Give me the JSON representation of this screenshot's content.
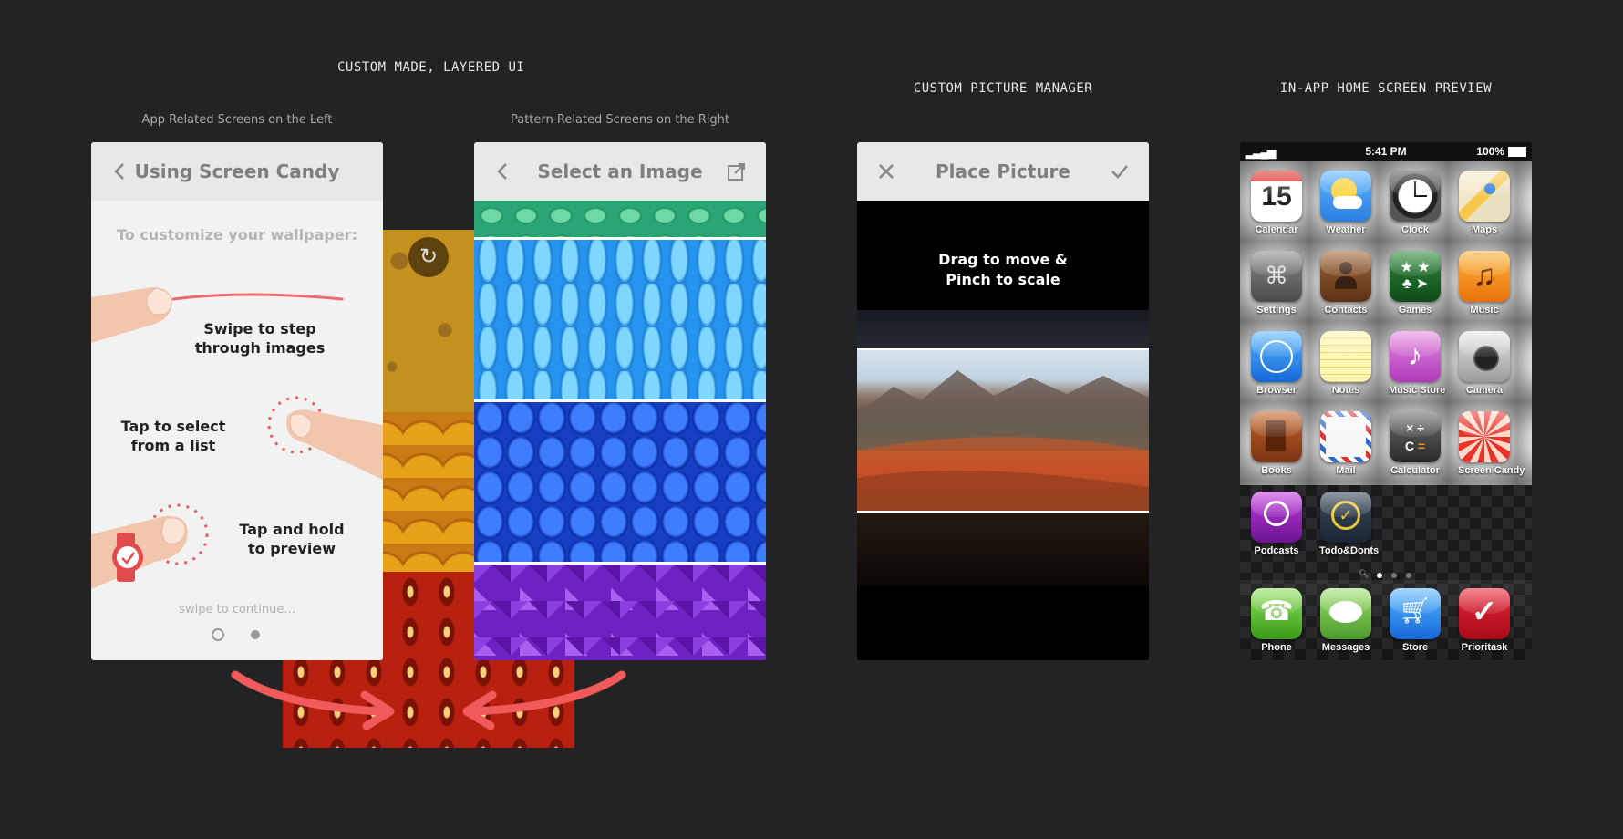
{
  "headings": {
    "layered": "CUSTOM MADE, LAYERED UI",
    "picture_manager": "CUSTOM PICTURE MANAGER",
    "home_preview": "IN-APP HOME SCREEN PREVIEW"
  },
  "captions": {
    "left": "App Related Screens on the Left",
    "right": "Pattern Related Screens on the Right"
  },
  "screen_help": {
    "title": "Using Screen Candy",
    "subtitle": "To customize your wallpaper:",
    "swipe": "Swipe to step\nthrough images",
    "tap": "Tap to select\nfrom a list",
    "hold": "Tap and hold\nto preview",
    "continue": "swipe to continue...",
    "page_count": 2,
    "active_page": 0
  },
  "screen_select": {
    "title": "Select an Image",
    "patterns": [
      "green-bubbles",
      "blue-drops",
      "blue-cobbles",
      "purple-crystals"
    ]
  },
  "screen_place": {
    "title": "Place Picture",
    "instruction": "Drag to move &\nPinch to scale"
  },
  "home_screen": {
    "status": {
      "time": "5:41 PM",
      "battery": "100%"
    },
    "calendar_day": "15",
    "apps": [
      {
        "label": "Calendar",
        "icon": "calendar-icon"
      },
      {
        "label": "Weather",
        "icon": "weather-icon"
      },
      {
        "label": "Clock",
        "icon": "clock-icon"
      },
      {
        "label": "Maps",
        "icon": "maps-icon"
      },
      {
        "label": "Settings",
        "icon": "settings-icon"
      },
      {
        "label": "Contacts",
        "icon": "contacts-icon"
      },
      {
        "label": "Games",
        "icon": "games-icon"
      },
      {
        "label": "Music",
        "icon": "music-icon"
      },
      {
        "label": "Browser",
        "icon": "browser-icon"
      },
      {
        "label": "Notes",
        "icon": "notes-icon"
      },
      {
        "label": "Music Store",
        "icon": "music-store-icon"
      },
      {
        "label": "Camera",
        "icon": "camera-icon"
      },
      {
        "label": "Books",
        "icon": "books-icon"
      },
      {
        "label": "Mail",
        "icon": "mail-icon"
      },
      {
        "label": "Calculator",
        "icon": "calculator-icon"
      },
      {
        "label": "Screen Candy",
        "icon": "screen-candy-icon"
      },
      {
        "label": "Podcasts",
        "icon": "podcasts-icon"
      },
      {
        "label": "Todo&Donts",
        "icon": "todo-icon"
      }
    ],
    "dock": [
      {
        "label": "Phone",
        "icon": "phone-icon"
      },
      {
        "label": "Messages",
        "icon": "messages-icon"
      },
      {
        "label": "Store",
        "icon": "store-icon"
      },
      {
        "label": "Prioritask",
        "icon": "prioritask-icon"
      }
    ],
    "page_count": 3,
    "active_page": 0
  }
}
